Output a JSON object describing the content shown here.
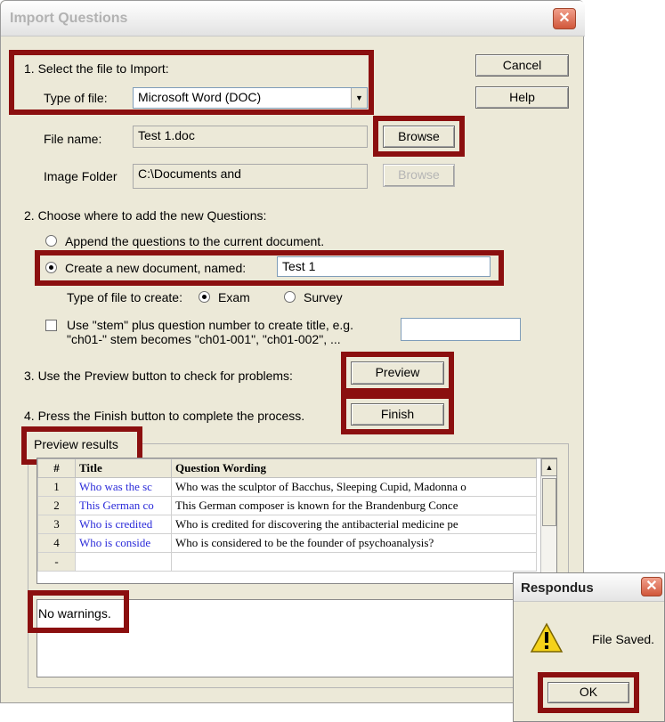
{
  "dialog": {
    "title": "Import Questions",
    "close": "✕",
    "cancel_label": "Cancel",
    "help_label": "Help"
  },
  "step1": {
    "heading": "1.  Select the file to Import:",
    "type_label": "Type of file:",
    "type_value": "Microsoft Word (DOC)",
    "file_label": "File name:",
    "file_value": "Test 1.doc",
    "browse_label": "Browse",
    "image_label": "Image Folder",
    "image_value": "C:\\Documents and",
    "image_browse_label": "Browse"
  },
  "step2": {
    "heading": "2.  Choose where to add the new Questions:",
    "append_label": "Append the questions to the current document.",
    "create_label": "Create a new document, named:",
    "create_value": "Test 1",
    "type_create_label": "Type of file to create:",
    "exam_label": "Exam",
    "survey_label": "Survey",
    "stem_line1": "Use \"stem\" plus question number to create title,  e.g.",
    "stem_line2": "\"ch01-\" stem becomes \"ch01-001\",  \"ch01-002\",  ..."
  },
  "step3": {
    "text": "3.  Use the Preview button to check for problems:",
    "preview_label": "Preview"
  },
  "step4": {
    "text": "4.  Press the Finish button to complete the process.",
    "finish_label": "Finish"
  },
  "preview": {
    "group_label": "Preview results",
    "columns": [
      "#",
      "Title",
      "Question Wording"
    ],
    "rows": [
      {
        "num": "1",
        "title": "Who was the sc",
        "wording": "Who was the sculptor of Bacchus, Sleeping Cupid, Madonna o"
      },
      {
        "num": "2",
        "title": "This German co",
        "wording": "This German composer is known for the Brandenburg Conce"
      },
      {
        "num": "3",
        "title": "Who is credited",
        "wording": "Who is credited for discovering the antibacterial medicine pe"
      },
      {
        "num": "4",
        "title": "Who is conside",
        "wording": "Who is considered to be the founder of psychoanalysis?"
      },
      {
        "num": "-",
        "title": "",
        "wording": ""
      }
    ],
    "warnings": "No warnings."
  },
  "popup": {
    "title": "Respondus",
    "close": "✕",
    "message": "File Saved.",
    "ok_label": "OK"
  },
  "colors": {
    "highlight": "#8b0f0f",
    "link_blue": "#2b2bd9"
  }
}
